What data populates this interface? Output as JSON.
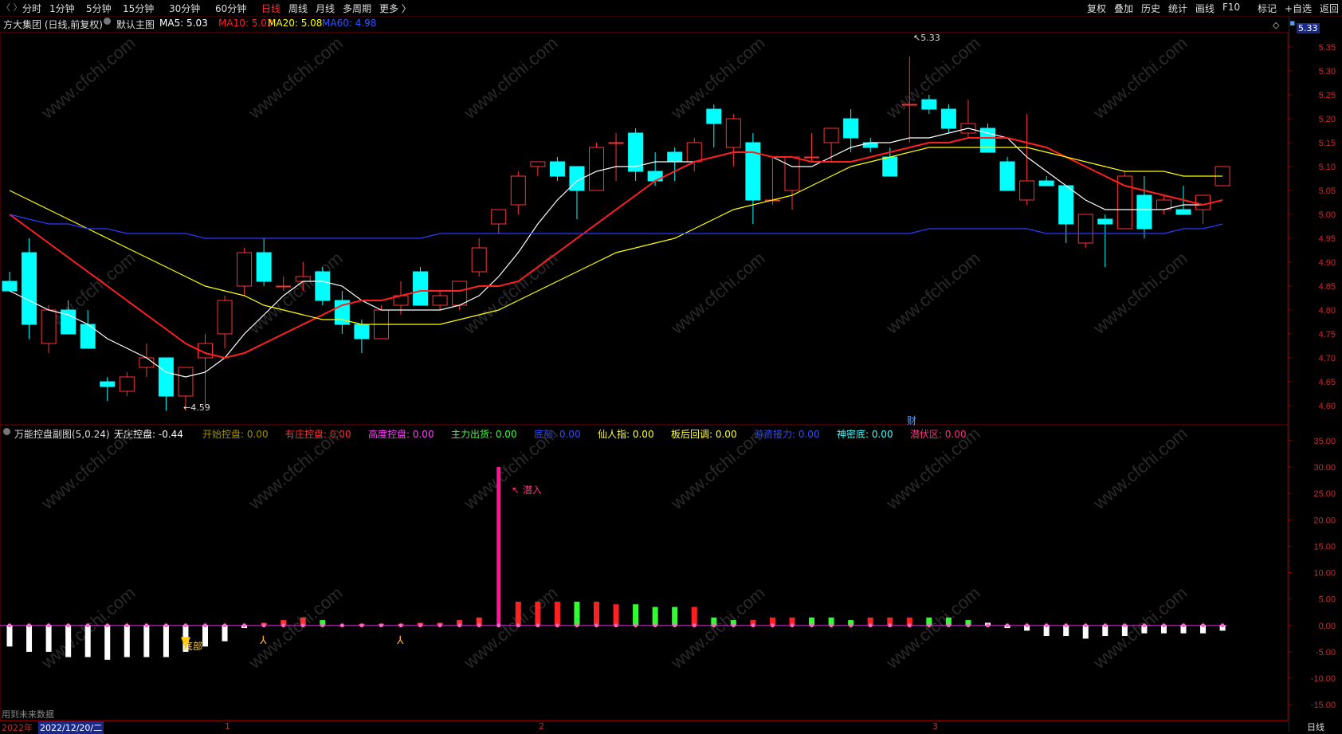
{
  "topbar": {
    "periods": [
      {
        "label": "分时",
        "active": false
      },
      {
        "label": "1分钟",
        "active": false
      },
      {
        "label": "5分钟",
        "active": false
      },
      {
        "label": "15分钟",
        "active": false
      },
      {
        "label": "30分钟",
        "active": false
      },
      {
        "label": "60分钟",
        "active": false
      },
      {
        "label": "日线",
        "active": true
      },
      {
        "label": "周线",
        "active": false
      },
      {
        "label": "月线",
        "active": false
      },
      {
        "label": "多周期",
        "active": false
      },
      {
        "label": "更多 〉",
        "active": false
      }
    ],
    "right_buttons": [
      "复权",
      "叠加",
      "历史",
      "统计",
      "画线",
      "F10",
      "标记",
      "+自选",
      "返回"
    ]
  },
  "main_info": {
    "stock": "方大集团 (日线,前复权)",
    "template": "默认主图",
    "ma": [
      {
        "label": "MA5: 5.03",
        "color": "#ffffff"
      },
      {
        "label": "MA10: 5.03",
        "color": "#ff2020"
      },
      {
        "label": "MA20: 5.08",
        "color": "#ffff00"
      },
      {
        "label": "MA60: 4.98",
        "color": "#3355ff"
      }
    ]
  },
  "sub_info": {
    "name": "万能控盘副图(5,0.24)",
    "items": [
      {
        "label": "无庄控盘: -0.44",
        "color": "#ffffff"
      },
      {
        "label": "开始控盘: 0.00",
        "color": "#a09000"
      },
      {
        "label": "有庄控盘: 0.00",
        "color": "#ff3030"
      },
      {
        "label": "高度控盘: 0.00",
        "color": "#ff40ff"
      },
      {
        "label": "主力出货: 0.00",
        "color": "#40ff40"
      },
      {
        "label": "底部: 0.00",
        "color": "#3050ff"
      },
      {
        "label": "仙人指: 0.00",
        "color": "#ffff40"
      },
      {
        "label": "板后回调: 0.00",
        "color": "#ffff40"
      },
      {
        "label": "游资接力: 0.00",
        "color": "#3050ff"
      },
      {
        "label": "神密底: 0.00",
        "color": "#40ffff"
      },
      {
        "label": "潜伏区: 0.00",
        "color": "#ff3080"
      }
    ]
  },
  "annotations": {
    "high": "5.33",
    "low": "4.59",
    "cai": "财",
    "qianru": "潜入",
    "dibu": "底部",
    "future_note": "用到未来数据",
    "current_price": "5.33"
  },
  "date_axis": {
    "year": "2022年",
    "cursor_date": "2022/12/20/二",
    "months": [
      "1",
      "2",
      "3"
    ]
  },
  "right_panel": {
    "timeframe": "日线"
  },
  "chart_data": [
    {
      "type": "candlestick",
      "title": "方大集团 (日线,前复权)",
      "ylim": [
        4.56,
        5.38
      ],
      "y_ticks": [
        "5.35",
        "5.30",
        "5.25",
        "5.20",
        "5.15",
        "5.10",
        "5.05",
        "5.00",
        "4.95",
        "4.90",
        "4.85",
        "4.80",
        "4.75",
        "4.70",
        "4.65",
        "4.60"
      ],
      "candles": [
        {
          "o": 4.86,
          "h": 4.88,
          "l": 4.84,
          "c": 4.84
        },
        {
          "o": 4.92,
          "h": 4.95,
          "l": 4.74,
          "c": 4.77
        },
        {
          "o": 4.73,
          "h": 4.81,
          "l": 4.71,
          "c": 4.8
        },
        {
          "o": 4.8,
          "h": 4.82,
          "l": 4.75,
          "c": 4.75
        },
        {
          "o": 4.77,
          "h": 4.8,
          "l": 4.72,
          "c": 4.72
        },
        {
          "o": 4.65,
          "h": 4.66,
          "l": 4.61,
          "c": 4.64
        },
        {
          "o": 4.63,
          "h": 4.67,
          "l": 4.62,
          "c": 4.66
        },
        {
          "o": 4.68,
          "h": 4.73,
          "l": 4.66,
          "c": 4.7
        },
        {
          "o": 4.7,
          "h": 4.7,
          "l": 4.59,
          "c": 4.62
        },
        {
          "o": 4.62,
          "h": 4.68,
          "l": 4.59,
          "c": 4.68
        },
        {
          "o": 4.7,
          "h": 4.75,
          "l": 4.6,
          "c": 4.73
        },
        {
          "o": 4.75,
          "h": 4.83,
          "l": 4.72,
          "c": 4.82
        },
        {
          "o": 4.85,
          "h": 4.93,
          "l": 4.83,
          "c": 4.92
        },
        {
          "o": 4.92,
          "h": 4.95,
          "l": 4.85,
          "c": 4.86
        },
        {
          "o": 4.85,
          "h": 4.87,
          "l": 4.84,
          "c": 4.85
        },
        {
          "o": 4.86,
          "h": 4.9,
          "l": 4.84,
          "c": 4.87
        },
        {
          "o": 4.88,
          "h": 4.89,
          "l": 4.81,
          "c": 4.82
        },
        {
          "o": 4.82,
          "h": 4.84,
          "l": 4.75,
          "c": 4.77
        },
        {
          "o": 4.77,
          "h": 4.78,
          "l": 4.71,
          "c": 4.74
        },
        {
          "o": 4.74,
          "h": 4.81,
          "l": 4.74,
          "c": 4.8
        },
        {
          "o": 4.81,
          "h": 4.86,
          "l": 4.79,
          "c": 4.83
        },
        {
          "o": 4.88,
          "h": 4.89,
          "l": 4.81,
          "c": 4.81
        },
        {
          "o": 4.81,
          "h": 4.84,
          "l": 4.8,
          "c": 4.83
        },
        {
          "o": 4.81,
          "h": 4.86,
          "l": 4.8,
          "c": 4.86
        },
        {
          "o": 4.88,
          "h": 4.95,
          "l": 4.87,
          "c": 4.93
        },
        {
          "o": 4.98,
          "h": 5.01,
          "l": 4.96,
          "c": 5.01
        },
        {
          "o": 5.02,
          "h": 5.09,
          "l": 5.0,
          "c": 5.08
        },
        {
          "o": 5.1,
          "h": 5.11,
          "l": 5.08,
          "c": 5.11
        },
        {
          "o": 5.11,
          "h": 5.12,
          "l": 5.07,
          "c": 5.08
        },
        {
          "o": 5.1,
          "h": 5.1,
          "l": 4.99,
          "c": 5.05
        },
        {
          "o": 5.05,
          "h": 5.15,
          "l": 5.05,
          "c": 5.14
        },
        {
          "o": 5.15,
          "h": 5.17,
          "l": 5.07,
          "c": 5.15
        },
        {
          "o": 5.17,
          "h": 5.18,
          "l": 5.07,
          "c": 5.09
        },
        {
          "o": 5.09,
          "h": 5.13,
          "l": 5.06,
          "c": 5.07
        },
        {
          "o": 5.13,
          "h": 5.14,
          "l": 5.07,
          "c": 5.11
        },
        {
          "o": 5.11,
          "h": 5.16,
          "l": 5.09,
          "c": 5.15
        },
        {
          "o": 5.22,
          "h": 5.23,
          "l": 5.14,
          "c": 5.19
        },
        {
          "o": 5.14,
          "h": 5.21,
          "l": 5.1,
          "c": 5.2
        },
        {
          "o": 5.15,
          "h": 5.17,
          "l": 4.98,
          "c": 5.03
        },
        {
          "o": 5.03,
          "h": 5.12,
          "l": 5.02,
          "c": 5.03
        },
        {
          "o": 5.05,
          "h": 5.12,
          "l": 5.01,
          "c": 5.12
        },
        {
          "o": 5.12,
          "h": 5.17,
          "l": 5.11,
          "c": 5.12
        },
        {
          "o": 5.15,
          "h": 5.18,
          "l": 5.11,
          "c": 5.18
        },
        {
          "o": 5.2,
          "h": 5.22,
          "l": 5.13,
          "c": 5.16
        },
        {
          "o": 5.15,
          "h": 5.16,
          "l": 5.13,
          "c": 5.14
        },
        {
          "o": 5.12,
          "h": 5.14,
          "l": 5.08,
          "c": 5.08
        },
        {
          "o": 5.23,
          "h": 5.33,
          "l": 5.15,
          "c": 5.23
        },
        {
          "o": 5.24,
          "h": 5.25,
          "l": 5.21,
          "c": 5.22
        },
        {
          "o": 5.22,
          "h": 5.23,
          "l": 5.17,
          "c": 5.18
        },
        {
          "o": 5.17,
          "h": 5.24,
          "l": 5.16,
          "c": 5.19
        },
        {
          "o": 5.18,
          "h": 5.19,
          "l": 5.13,
          "c": 5.13
        },
        {
          "o": 5.11,
          "h": 5.12,
          "l": 5.05,
          "c": 5.05
        },
        {
          "o": 5.03,
          "h": 5.21,
          "l": 5.02,
          "c": 5.07
        },
        {
          "o": 5.07,
          "h": 5.08,
          "l": 5.06,
          "c": 5.06
        },
        {
          "o": 5.06,
          "h": 5.06,
          "l": 4.94,
          "c": 4.98
        },
        {
          "o": 4.94,
          "h": 5.0,
          "l": 4.93,
          "c": 5.0
        },
        {
          "o": 4.99,
          "h": 5.0,
          "l": 4.89,
          "c": 4.98
        },
        {
          "o": 4.97,
          "h": 5.09,
          "l": 4.97,
          "c": 5.08
        },
        {
          "o": 5.04,
          "h": 5.08,
          "l": 4.95,
          "c": 4.97
        },
        {
          "o": 5.01,
          "h": 5.04,
          "l": 5.0,
          "c": 5.03
        },
        {
          "o": 5.01,
          "h": 5.06,
          "l": 5.0,
          "c": 5.0
        },
        {
          "o": 5.01,
          "h": 5.04,
          "l": 4.98,
          "c": 5.04
        },
        {
          "o": 5.06,
          "h": 5.1,
          "l": 5.06,
          "c": 5.1
        }
      ],
      "series": [
        {
          "name": "MA5",
          "color": "#ffffff",
          "values": [
            4.84,
            4.82,
            4.8,
            4.79,
            4.77,
            4.74,
            4.72,
            4.7,
            4.67,
            4.66,
            4.67,
            4.7,
            4.75,
            4.79,
            4.83,
            4.86,
            4.86,
            4.85,
            4.82,
            4.8,
            4.8,
            4.8,
            4.8,
            4.81,
            4.83,
            4.87,
            4.92,
            4.98,
            5.03,
            5.07,
            5.09,
            5.1,
            5.1,
            5.11,
            5.11,
            5.11,
            5.12,
            5.13,
            5.13,
            5.12,
            5.1,
            5.1,
            5.12,
            5.14,
            5.15,
            5.15,
            5.16,
            5.16,
            5.17,
            5.18,
            5.17,
            5.16,
            5.12,
            5.09,
            5.06,
            5.03,
            5.01,
            5.01,
            5.01,
            5.01,
            5.02,
            5.02,
            5.03
          ]
        },
        {
          "name": "MA10",
          "color": "#ff2020",
          "values": [
            5.0,
            4.97,
            4.94,
            4.91,
            4.88,
            4.85,
            4.82,
            4.79,
            4.76,
            4.73,
            4.71,
            4.7,
            4.71,
            4.73,
            4.75,
            4.77,
            4.79,
            4.81,
            4.82,
            4.82,
            4.83,
            4.84,
            4.84,
            4.84,
            4.85,
            4.85,
            4.86,
            4.89,
            4.92,
            4.95,
            4.98,
            5.01,
            5.04,
            5.07,
            5.09,
            5.11,
            5.12,
            5.13,
            5.13,
            5.12,
            5.12,
            5.11,
            5.11,
            5.11,
            5.12,
            5.13,
            5.14,
            5.15,
            5.15,
            5.16,
            5.16,
            5.16,
            5.15,
            5.14,
            5.12,
            5.1,
            5.08,
            5.06,
            5.05,
            5.04,
            5.03,
            5.02,
            5.03
          ]
        },
        {
          "name": "MA20",
          "color": "#ffff00",
          "values": [
            5.05,
            5.03,
            5.01,
            4.99,
            4.97,
            4.95,
            4.93,
            4.91,
            4.89,
            4.87,
            4.85,
            4.84,
            4.83,
            4.81,
            4.8,
            4.79,
            4.78,
            4.78,
            4.77,
            4.77,
            4.77,
            4.77,
            4.77,
            4.78,
            4.79,
            4.8,
            4.82,
            4.84,
            4.86,
            4.88,
            4.9,
            4.92,
            4.93,
            4.94,
            4.95,
            4.97,
            4.99,
            5.01,
            5.02,
            5.03,
            5.04,
            5.06,
            5.08,
            5.1,
            5.11,
            5.12,
            5.13,
            5.14,
            5.14,
            5.14,
            5.14,
            5.14,
            5.14,
            5.13,
            5.12,
            5.11,
            5.1,
            5.09,
            5.09,
            5.09,
            5.08,
            5.08,
            5.08
          ]
        },
        {
          "name": "MA60",
          "color": "#2a3cff",
          "values": [
            5.0,
            4.99,
            4.98,
            4.98,
            4.97,
            4.97,
            4.96,
            4.96,
            4.96,
            4.96,
            4.95,
            4.95,
            4.95,
            4.95,
            4.95,
            4.95,
            4.95,
            4.95,
            4.95,
            4.95,
            4.95,
            4.95,
            4.96,
            4.96,
            4.96,
            4.96,
            4.96,
            4.96,
            4.96,
            4.96,
            4.96,
            4.96,
            4.96,
            4.96,
            4.96,
            4.96,
            4.96,
            4.96,
            4.96,
            4.96,
            4.96,
            4.96,
            4.96,
            4.96,
            4.96,
            4.96,
            4.96,
            4.97,
            4.97,
            4.97,
            4.97,
            4.97,
            4.97,
            4.96,
            4.96,
            4.96,
            4.96,
            4.96,
            4.96,
            4.96,
            4.97,
            4.97,
            4.98
          ]
        }
      ]
    },
    {
      "type": "bar",
      "title": "万能控盘副图(5,0.24)",
      "ylim": [
        -18,
        38
      ],
      "y_ticks": [
        "35.00",
        "30.00",
        "25.00",
        "20.00",
        "15.00",
        "10.00",
        "5.00",
        "0.00",
        "-5.00",
        "-10.00",
        "-15.00"
      ],
      "values": [
        -4,
        -5,
        -5,
        -6,
        -6,
        -6.5,
        -6,
        -6,
        -6,
        -5,
        -4,
        -3,
        -0.5,
        0.5,
        1,
        1.5,
        1,
        0,
        0.3,
        0.3,
        0.3,
        0.5,
        0.5,
        1,
        1.5,
        30,
        4.5,
        4.5,
        4.5,
        4.5,
        4.5,
        4,
        4,
        3.5,
        3.5,
        3.5,
        1.5,
        1,
        1,
        1.5,
        1.5,
        1.5,
        1.5,
        1,
        1.5,
        1.5,
        1.5,
        1.5,
        1.5,
        1,
        0.5,
        -0.5,
        -1,
        -2,
        -2,
        -2.5,
        -2,
        -2,
        -1.5,
        -1.5,
        -1.5,
        -1.5,
        -1
      ],
      "colors": [
        "#ffffff",
        "#ffffff",
        "#ffffff",
        "#ffffff",
        "#ffffff",
        "#ffffff",
        "#ffffff",
        "#ffffff",
        "#ffffff",
        "#ffffff",
        "#ffffff",
        "#ffffff",
        "#ffffff",
        "#ff3030",
        "#ff3030",
        "#ff3030",
        "#30ff30",
        "#ff3030",
        "#ff3030",
        "#ff3030",
        "#ff3030",
        "#ff3030",
        "#ff3030",
        "#ff3030",
        "#ff3030",
        "#ff1493",
        "#ff2020",
        "#ff2020",
        "#ff2020",
        "#30ff30",
        "#ff2020",
        "#ff2020",
        "#30ff30",
        "#30ff30",
        "#30ff30",
        "#ff2020",
        "#30ff30",
        "#30ff30",
        "#ff2020",
        "#ff2020",
        "#ff2020",
        "#30ff30",
        "#30ff30",
        "#30ff30",
        "#ff2020",
        "#ff2020",
        "#ff2020",
        "#30ff30",
        "#30ff30",
        "#30ff30",
        "#ffffff",
        "#ffffff",
        "#ffffff",
        "#ffffff",
        "#ffffff",
        "#ffffff",
        "#ffffff",
        "#ffffff",
        "#ffffff",
        "#ffffff",
        "#ffffff",
        "#ffffff",
        "#ffffff"
      ]
    }
  ]
}
